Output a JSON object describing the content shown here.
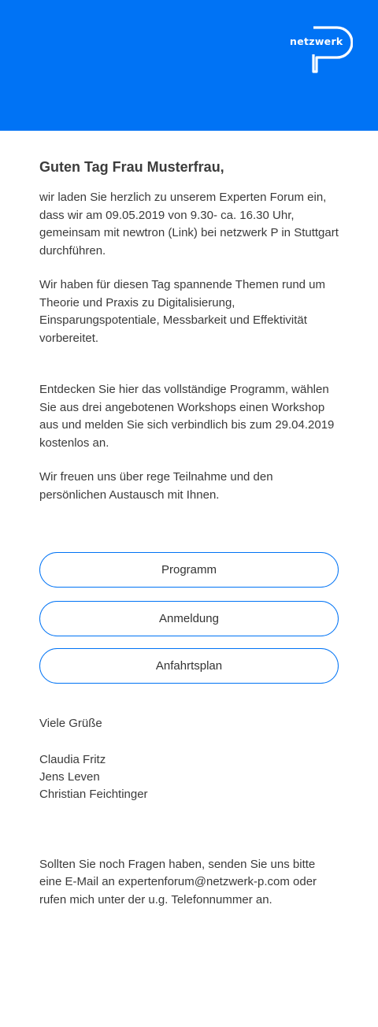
{
  "header": {
    "brand_color": "#0073f5",
    "logo_text": "netzwerk",
    "logo_icon": "p-logo-icon"
  },
  "email": {
    "greeting": "Guten Tag Frau Musterfrau,",
    "paragraphs": [
      "wir laden Sie herzlich zu unserem Experten Forum ein, dass wir am 09.05.2019 von 9.30- ca. 16.30 Uhr, gemeinsam mit newtron (Link) bei netzwerk P in Stuttgart durchführen.",
      "Wir haben für diesen Tag spannende Themen rund um Theorie und Praxis zu Digitalisierung, Einsparungspotentiale, Messbarkeit und Effektivität vorbereitet.",
      "Entdecken Sie hier das vollständige Programm, wählen Sie aus drei angebotenen Workshops einen Workshop aus und melden Sie sich verbindlich bis zum 29.04.2019 kostenlos an.",
      "Wir freuen uns über rege Teilnahme und den persönlichen Austausch mit Ihnen."
    ],
    "buttons": {
      "program": "Programm",
      "registration": "Anmeldung",
      "directions": "Anfahrtsplan"
    },
    "closing": "Viele Grüße",
    "signatories": [
      "Claudia Fritz",
      "Jens Leven",
      "Christian Feichtinger"
    ],
    "footer": "Sollten Sie noch Fragen haben, senden Sie uns bitte eine E-Mail an expertenforum@netzwerk-p.com oder rufen mich unter der u.g. Telefonnummer an."
  }
}
